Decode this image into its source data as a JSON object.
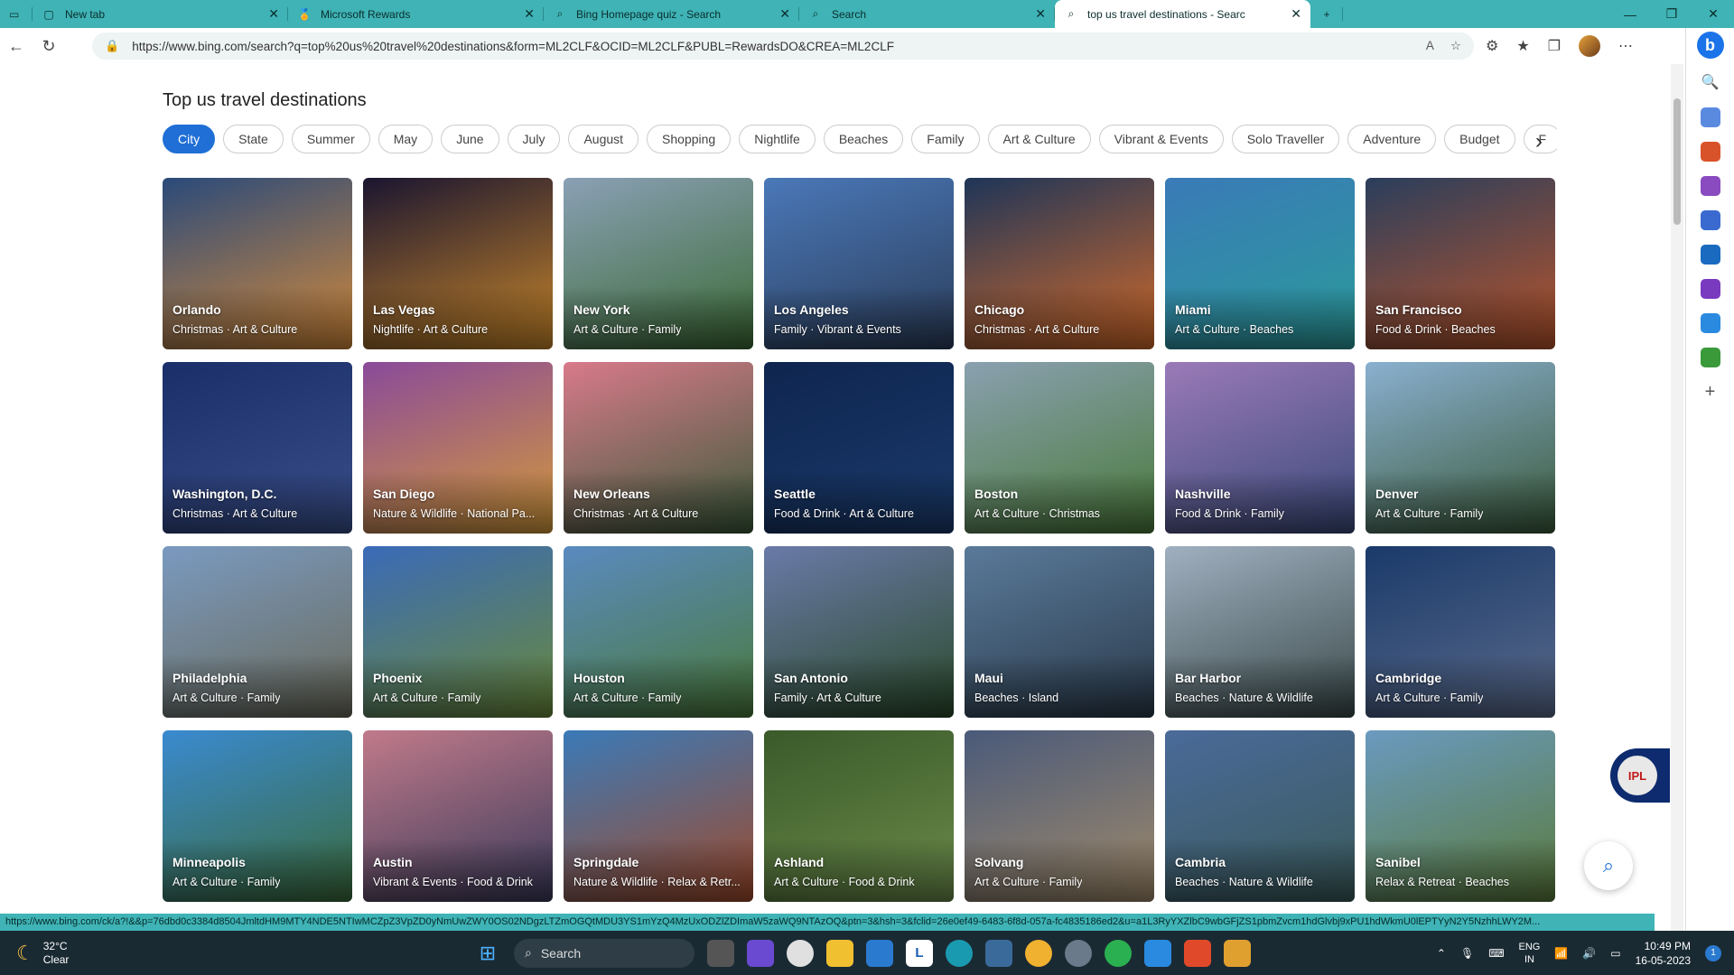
{
  "browser": {
    "tabs": [
      {
        "label": "New tab",
        "icon": "newtab-icon"
      },
      {
        "label": "Microsoft Rewards",
        "icon": "rewards-icon"
      },
      {
        "label": "Bing Homepage quiz - Search",
        "icon": "search-icon"
      },
      {
        "label": "Search",
        "icon": "search-icon"
      },
      {
        "label": "top us travel destinations - Searc",
        "icon": "search-icon",
        "active": true
      }
    ],
    "url": "https://www.bing.com/search?q=top%20us%20travel%20destinations&form=ML2CLF&OCID=ML2CLF&PUBL=RewardsDO&CREA=ML2CLF",
    "status_url": "https://www.bing.com/ck/a?!&&p=76dbd0c3384d8504JmltdHM9MTY4NDE5NTIwMCZpZ3VpZD0yNmUwZWY0OS02NDgzLTZmOGQtMDU3YS1mYzQ4MzUxODZlZDImaW5zaWQ9NTAzOQ&ptn=3&hsh=3&fclid=26e0ef49-6483-6f8d-057a-fc4835186ed2&u=a1L3RyYXZlbC9wbGFjZS1pbmZvcm1hdGlvbj9xPU1hdWkmU0lEPTYyN2Y5NzhhLWY2M..."
  },
  "page": {
    "title": "Top us travel destinations",
    "chips": [
      "City",
      "State",
      "Summer",
      "May",
      "June",
      "July",
      "August",
      "Shopping",
      "Nightlife",
      "Beaches",
      "Family",
      "Art & Culture",
      "Vibrant & Events",
      "Solo Traveller",
      "Adventure",
      "Budget",
      "F"
    ],
    "active_chip": "City",
    "destinations": [
      {
        "name": "Orlando",
        "tags": "Christmas · Art & Culture",
        "bg": "#2a4a7a",
        "bg2": "#d48a3a"
      },
      {
        "name": "Las Vegas",
        "tags": "Nightlife · Art & Culture",
        "bg": "#1a1530",
        "bg2": "#c8862a"
      },
      {
        "name": "New York",
        "tags": "Art & Culture · Family",
        "bg": "#8aa0b5",
        "bg2": "#3b6a35"
      },
      {
        "name": "Los Angeles",
        "tags": "Family · Vibrant & Events",
        "bg": "#4a78b8",
        "bg2": "#2b3d5a"
      },
      {
        "name": "Chicago",
        "tags": "Christmas · Art & Culture",
        "bg": "#1e3558",
        "bg2": "#d26a2a"
      },
      {
        "name": "Miami",
        "tags": "Art & Culture · Beaches",
        "bg": "#3a7bb8",
        "bg2": "#2a9a9a"
      },
      {
        "name": "San Francisco",
        "tags": "Food & Drink · Beaches",
        "bg": "#2a3e5c",
        "bg2": "#b8542a"
      },
      {
        "name": "Washington, D.C.",
        "tags": "Christmas · Art & Culture",
        "bg": "#1a2f6a",
        "bg2": "#3a4f8a"
      },
      {
        "name": "San Diego",
        "tags": "Nature & Wildlife · National Pa...",
        "bg": "#8a4a9a",
        "bg2": "#d49a3a"
      },
      {
        "name": "New Orleans",
        "tags": "Christmas · Art & Culture",
        "bg": "#d87a8a",
        "bg2": "#3a5a3a"
      },
      {
        "name": "Seattle",
        "tags": "Food & Drink · Art & Culture",
        "bg": "#0f2550",
        "bg2": "#1a3a6a"
      },
      {
        "name": "Boston",
        "tags": "Art & Culture · Christmas",
        "bg": "#8aa0b0",
        "bg2": "#4a7a3a"
      },
      {
        "name": "Nashville",
        "tags": "Food & Drink · Family",
        "bg": "#9a7ab8",
        "bg2": "#3a4a7a"
      },
      {
        "name": "Denver",
        "tags": "Art & Culture · Family",
        "bg": "#8ab0d0",
        "bg2": "#3a5a3a"
      },
      {
        "name": "Philadelphia",
        "tags": "Art & Culture · Family",
        "bg": "#7a9ac0",
        "bg2": "#6a6a5a"
      },
      {
        "name": "Phoenix",
        "tags": "Art & Culture · Family",
        "bg": "#3a6ab8",
        "bg2": "#6a8a3a"
      },
      {
        "name": "Houston",
        "tags": "Art & Culture · Family",
        "bg": "#5a8ac0",
        "bg2": "#4a7a3a"
      },
      {
        "name": "San Antonio",
        "tags": "Family · Art & Culture",
        "bg": "#6a7aa8",
        "bg2": "#2a4a2a"
      },
      {
        "name": "Maui",
        "tags": "Beaches · Island",
        "bg": "#5a7a9a",
        "bg2": "#2a3a4a"
      },
      {
        "name": "Bar Harbor",
        "tags": "Beaches · Nature & Wildlife",
        "bg": "#a0b0c0",
        "bg2": "#3a4a4a"
      },
      {
        "name": "Cambridge",
        "tags": "Art & Culture · Family",
        "bg": "#1a3a6a",
        "bg2": "#5a6a8a"
      },
      {
        "name": "Minneapolis",
        "tags": "Art & Culture · Family",
        "bg": "#3a8ad0",
        "bg2": "#3a6a3a"
      },
      {
        "name": "Austin",
        "tags": "Vibrant & Events · Food & Drink",
        "bg": "#c07a8a",
        "bg2": "#3a3a5a"
      },
      {
        "name": "Springdale",
        "tags": "Nature & Wildlife · Relax & Retr...",
        "bg": "#3a7ab8",
        "bg2": "#a04a2a"
      },
      {
        "name": "Ashland",
        "tags": "Art & Culture · Food & Drink",
        "bg": "#3a5a2a",
        "bg2": "#6a8a4a"
      },
      {
        "name": "Solvang",
        "tags": "Art & Culture · Family",
        "bg": "#4a5a7a",
        "bg2": "#a08a6a"
      },
      {
        "name": "Cambria",
        "tags": "Beaches · Nature & Wildlife",
        "bg": "#4a6a9a",
        "bg2": "#3a5a5a"
      },
      {
        "name": "Sanibel",
        "tags": "Relax & Retreat · Beaches",
        "bg": "#6a9ac0",
        "bg2": "#5a7a3a"
      }
    ],
    "ipl_label": "IPL"
  },
  "taskbar": {
    "temperature": "32°C",
    "condition": "Clear",
    "search_label": "Search",
    "lang_line1": "ENG",
    "lang_line2": "IN",
    "time": "10:49 PM",
    "date": "16-05-2023",
    "notification_count": "1"
  }
}
